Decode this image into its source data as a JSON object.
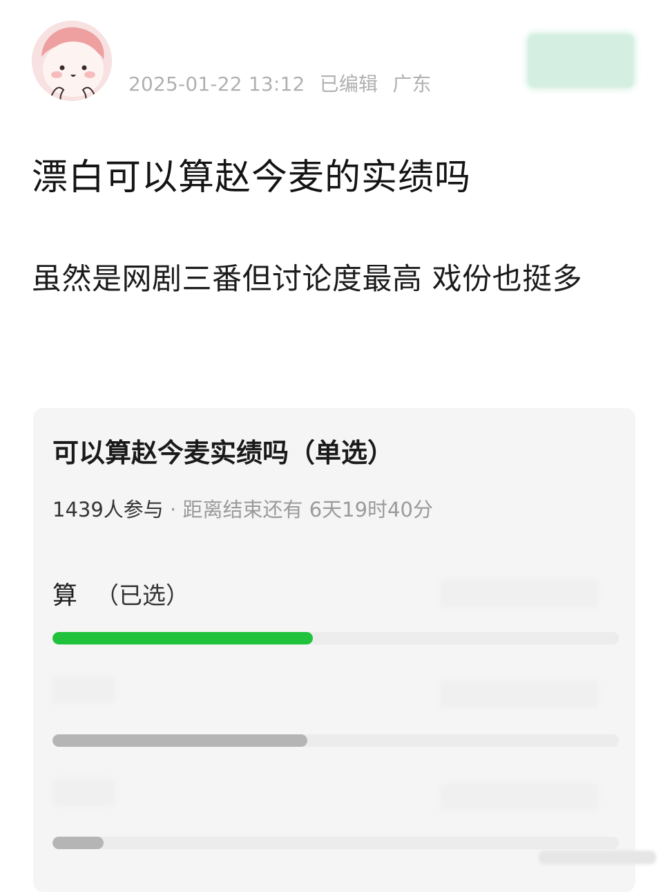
{
  "post": {
    "timestamp": "2025-01-22 13:12",
    "edited": "已编辑",
    "location": "广东",
    "title": "漂白可以算赵今麦的实绩吗",
    "content": "虽然是网剧三番但讨论度最高 戏份也挺多"
  },
  "poll": {
    "title": "可以算赵今麦实绩吗（单选）",
    "participants": "1439人参与",
    "separator": " · ",
    "countdown_label": "距离结束还有 ",
    "countdown": "6天19时40分",
    "options": [
      {
        "label": "算",
        "selected_tag": "（已选）",
        "fraction": 0.46,
        "bar_color": "#1fc23a"
      },
      {
        "label": "",
        "fraction": 0.45,
        "bar_color": "#b5b5b5"
      },
      {
        "label": "",
        "fraction": 0.09,
        "bar_color": "#b5b5b5"
      }
    ]
  },
  "colors": {
    "accent_green": "#1fc23a",
    "poll_background": "#f5f5f5",
    "meta_text": "#b0b0b0"
  },
  "icons": {
    "avatar": "cartoon-dumpling-avatar"
  }
}
